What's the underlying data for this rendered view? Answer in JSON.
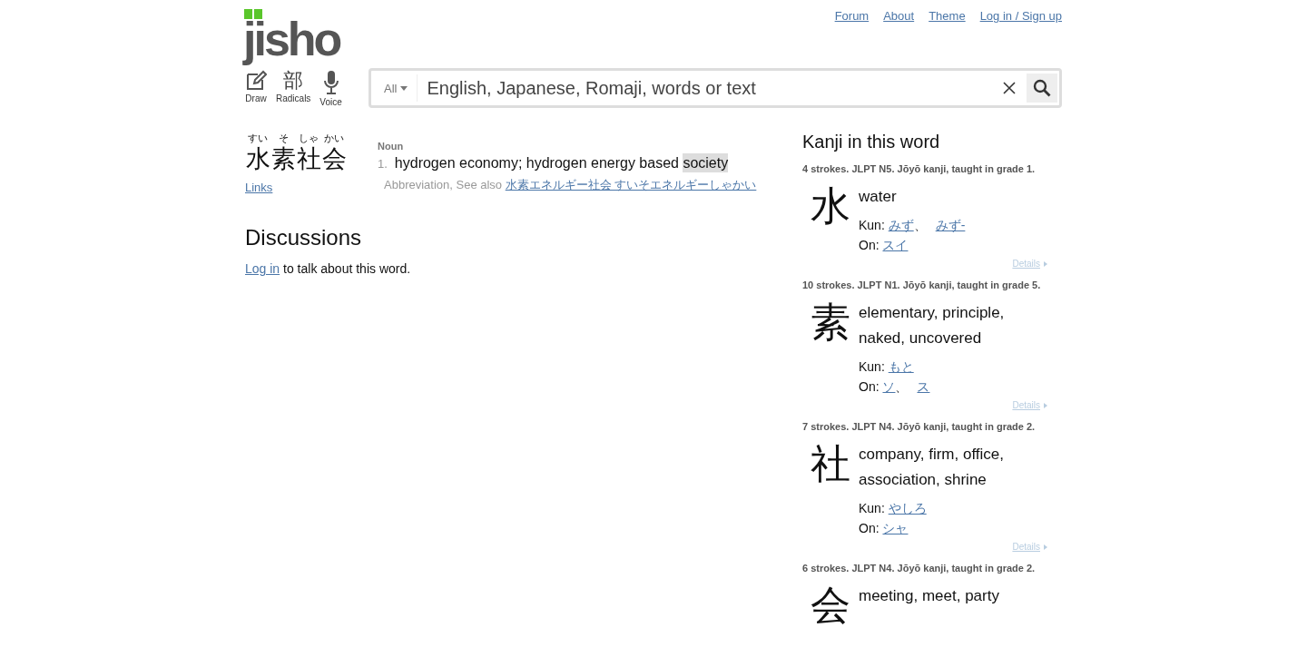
{
  "nav": [
    {
      "label": "Forum"
    },
    {
      "label": "About"
    },
    {
      "label": "Theme"
    },
    {
      "label": "Log in / Sign up"
    }
  ],
  "logo": "jisho",
  "tools": [
    {
      "label": "Draw",
      "kind": "draw"
    },
    {
      "label": "Radicals",
      "kind": "radicals",
      "glyph": "部"
    },
    {
      "label": "Voice",
      "kind": "voice"
    }
  ],
  "search": {
    "filter": "All",
    "placeholder": "English, Japanese, Romaji, words or text"
  },
  "word": {
    "furigana": [
      "すい",
      "そ",
      "しゃ",
      "かい"
    ],
    "characters": [
      "水",
      "素",
      "社",
      "会"
    ],
    "links": "Links",
    "part_of_speech": "Noun",
    "senses": [
      {
        "number": "1.",
        "meaning": [
          {
            "text": "hydrogen economy; hydrogen energy based ",
            "highlighted": false
          },
          {
            "text": "society",
            "highlighted": true
          }
        ],
        "note": "Abbreviation, See also",
        "see_also": "水素エネルギー社会 すいそエネルギーしゃかい"
      }
    ]
  },
  "discussions": {
    "title": "Discussions",
    "login_link": "Log in",
    "text": " to talk about this word."
  },
  "kanji_panel": {
    "title": "Kanji in this word",
    "kanji": [
      {
        "info": "4 strokes. JLPT N5. Jōyō kanji, taught in grade 1.",
        "character": "水",
        "meaning": "water",
        "readings": [
          {
            "label": "Kun:",
            "values": [
              "みず",
              "みず-"
            ],
            "separator": "、"
          },
          {
            "label": "On:",
            "values": [
              "スイ"
            ]
          }
        ],
        "details": "Details"
      },
      {
        "info": "10 strokes. JLPT N1. Jōyō kanji, taught in grade 5.",
        "character": "素",
        "meaning": "elementary, principle, naked, uncovered",
        "readings": [
          {
            "label": "Kun:",
            "values": [
              "もと"
            ]
          },
          {
            "label": "On:",
            "values": [
              "ソ",
              "ス"
            ],
            "separator": "、"
          }
        ],
        "details": "Details"
      },
      {
        "info": "7 strokes. JLPT N4. Jōyō kanji, taught in grade 2.",
        "character": "社",
        "meaning": "company, firm, office, association, shrine",
        "readings": [
          {
            "label": "Kun:",
            "values": [
              "やしろ"
            ]
          },
          {
            "label": "On:",
            "values": [
              "シャ"
            ]
          }
        ],
        "details": "Details"
      },
      {
        "info": "6 strokes. JLPT N4. Jōyō kanji, taught in grade 2.",
        "character": "会",
        "meaning": "meeting, meet, party"
      }
    ]
  }
}
